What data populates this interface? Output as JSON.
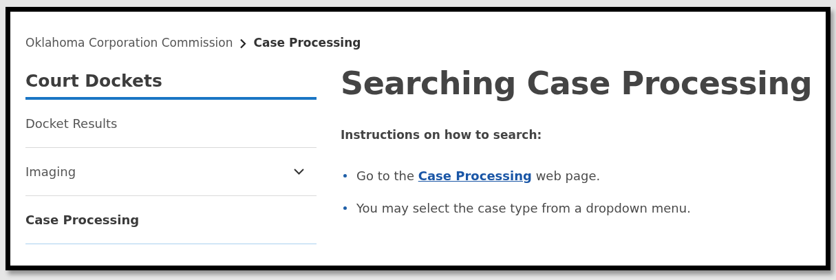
{
  "breadcrumb": [
    {
      "label": "Oklahoma Corporation Commission",
      "current": false
    },
    {
      "label": "Case Processing",
      "current": true
    }
  ],
  "sidebar": {
    "title": "Court Dockets",
    "items": [
      {
        "label": "Docket Results",
        "kind": "link",
        "selected": false
      },
      {
        "label": "Imaging",
        "kind": "group",
        "expanded": false,
        "selected": false
      },
      {
        "label": "Case Processing",
        "kind": "link",
        "selected": true
      }
    ]
  },
  "main": {
    "heading": "Searching Case Processing",
    "subheading": "Instructions on how to search:",
    "bullets": [
      {
        "kind": "link",
        "before": "Go to the ",
        "link": "Case Processing",
        "after": " web page."
      },
      {
        "kind": "text",
        "text": "You may select the case type from a dropdown menu."
      }
    ]
  }
}
